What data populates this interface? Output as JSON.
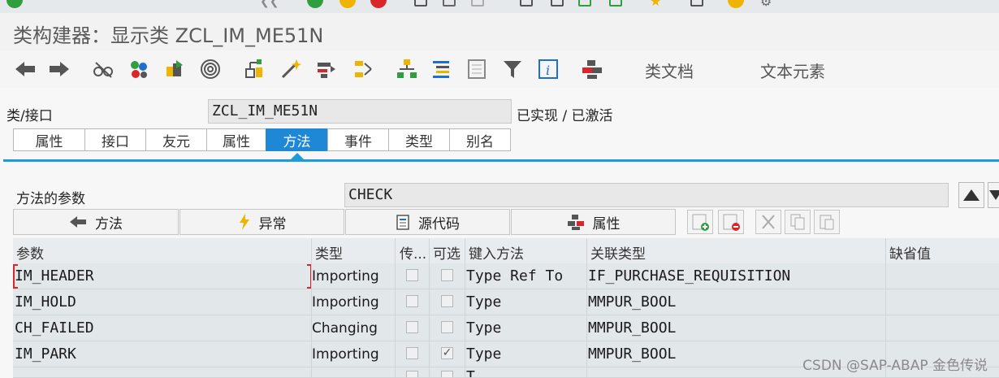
{
  "window": {
    "title": "类构建器：显示类 ZCL_IM_ME51N"
  },
  "toolbar": {
    "icons": [
      "back-arrow-icon",
      "forward-arrow-icon",
      "glasses-icon",
      "colors-icon",
      "transport-icon",
      "spiral-icon",
      "hierarchy-icon",
      "wand-icon",
      "navigate-icon",
      "move-icon",
      "tree-icon",
      "list-icon",
      "document-icon",
      "filter-icon",
      "info-icon",
      "structure-icon"
    ],
    "class_doc": "类文档",
    "text_elements": "文本元素"
  },
  "header": {
    "class_label": "类/接口",
    "class_value": "ZCL_IM_ME51N",
    "status": "已实现 / 已激活"
  },
  "tabs": [
    "属性",
    "接口",
    "友元",
    "属性",
    "方法",
    "事件",
    "类型",
    "别名"
  ],
  "active_tab": "方法",
  "method_params": {
    "label": "方法的参数",
    "method_value": "CHECK"
  },
  "buttons": {
    "methods": "方法",
    "exceptions": "异常",
    "source": "源代码",
    "attributes": "属性"
  },
  "table": {
    "headers": [
      "参数",
      "类型",
      "传...",
      "可选",
      "键入方法",
      "关联类型",
      "缺省值"
    ],
    "rows": [
      {
        "param": "IM_HEADER",
        "type": "Importing",
        "pass_value": false,
        "optional": false,
        "typing": "Type Ref To",
        "assoc": "IF_PURCHASE_REQUISITION",
        "default": ""
      },
      {
        "param": "IM_HOLD",
        "type": "Importing",
        "pass_value": false,
        "optional": false,
        "typing": "Type",
        "assoc": "MMPUR_BOOL",
        "default": ""
      },
      {
        "param": "CH_FAILED",
        "type": "Changing",
        "pass_value": false,
        "optional": false,
        "typing": "Type",
        "assoc": "MMPUR_BOOL",
        "default": ""
      },
      {
        "param": "IM_PARK",
        "type": "Importing",
        "pass_value": false,
        "optional": true,
        "typing": "Type",
        "assoc": "MMPUR_BOOL",
        "default": ""
      },
      {
        "param": "",
        "type": "",
        "pass_value": false,
        "optional": false,
        "typing": "T",
        "assoc": "",
        "default": ""
      }
    ]
  },
  "watermark": "CSDN @SAP-ABAP 金色传说"
}
